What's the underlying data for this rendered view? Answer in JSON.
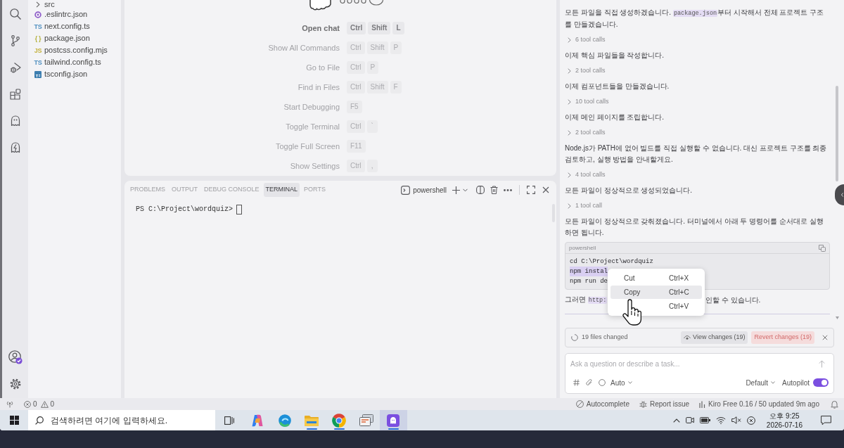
{
  "activity_bar": {
    "top": [
      {
        "kind": "search"
      },
      {
        "kind": "source_control"
      },
      {
        "kind": "run_debug"
      },
      {
        "kind": "extensions"
      },
      {
        "kind": "ghost"
      },
      {
        "kind": "ghost_bolt"
      }
    ],
    "bottom": [
      {
        "kind": "account"
      },
      {
        "kind": "settings"
      }
    ]
  },
  "explorer": {
    "items": [
      {
        "kind": "folder",
        "name": "src",
        "expanded": false
      },
      {
        "kind": "file",
        "name": ".eslintrc.json",
        "icon": {
          "kind": "ring",
          "color": "#8e5bc9"
        }
      },
      {
        "kind": "file",
        "name": "next.config.ts",
        "icon": {
          "kind": "glyph",
          "text": "TS",
          "color": "#4f8fc0"
        }
      },
      {
        "kind": "file",
        "name": "package.json",
        "icon": {
          "kind": "glyph",
          "text": "{ }",
          "color": "#b3b03a"
        }
      },
      {
        "kind": "file",
        "name": "postcss.config.mjs",
        "icon": {
          "kind": "glyph",
          "text": "JS",
          "color": "#c4b13e"
        }
      },
      {
        "kind": "file",
        "name": "tailwind.config.ts",
        "icon": {
          "kind": "glyph",
          "text": "TS",
          "color": "#4f8fc0"
        }
      },
      {
        "kind": "file",
        "name": "tsconfig.json",
        "icon": {
          "kind": "tile",
          "color": "#3d7eb0"
        }
      }
    ]
  },
  "welcome": {
    "shortcuts": [
      {
        "label": "Open chat",
        "keys": [
          "Ctrl",
          "Shift",
          "L"
        ],
        "emphasized": true
      },
      {
        "label": "Show All Commands",
        "keys": [
          "Ctrl",
          "Shift",
          "P"
        ],
        "emphasized": false
      },
      {
        "label": "Go to File",
        "keys": [
          "Ctrl",
          "P"
        ],
        "emphasized": false
      },
      {
        "label": "Find in Files",
        "keys": [
          "Ctrl",
          "Shift",
          "F"
        ],
        "emphasized": false
      },
      {
        "label": "Start Debugging",
        "keys": [
          "F5"
        ],
        "emphasized": false
      },
      {
        "label": "Toggle Terminal",
        "keys": [
          "Ctrl",
          "`"
        ],
        "emphasized": false
      },
      {
        "label": "Toggle Full Screen",
        "keys": [
          "F11"
        ],
        "emphasized": false
      },
      {
        "label": "Show Settings",
        "keys": [
          "Ctrl",
          ","
        ],
        "emphasized": false
      }
    ]
  },
  "panel": {
    "tabs": [
      {
        "label": "PROBLEMS",
        "selected": false
      },
      {
        "label": "OUTPUT",
        "selected": false
      },
      {
        "label": "DEBUG CONSOLE",
        "selected": false
      },
      {
        "label": "TERMINAL",
        "selected": true
      },
      {
        "label": "PORTS",
        "selected": false
      }
    ],
    "terminal": {
      "shell": "powershell",
      "prompt": "PS C:\\Project\\wordquiz>"
    }
  },
  "chat": {
    "items": [
      {
        "kind": "message",
        "segments": [
          {
            "kind": "text",
            "text": "모든 파일을 직접 생성하겠습니다. "
          },
          {
            "kind": "code",
            "text": "package.json"
          },
          {
            "kind": "text",
            "text": "부터 시작해서 전체 프로젝트 구조를 만들겠습니다."
          }
        ]
      },
      {
        "kind": "tool_calls",
        "label": "6 tool calls",
        "expanded": false
      },
      {
        "kind": "message",
        "segments": [
          {
            "kind": "text",
            "text": "이제 핵심 파일들을 작성합니다."
          }
        ]
      },
      {
        "kind": "tool_calls",
        "label": "2 tool calls",
        "expanded": false
      },
      {
        "kind": "message",
        "segments": [
          {
            "kind": "text",
            "text": "이제 컴포넌트들을 만들겠습니다."
          }
        ]
      },
      {
        "kind": "tool_calls",
        "label": "10 tool calls",
        "expanded": false
      },
      {
        "kind": "message",
        "segments": [
          {
            "kind": "text",
            "text": "이제 메인 페이지를 조립합니다."
          }
        ]
      },
      {
        "kind": "tool_calls",
        "label": "2 tool calls",
        "expanded": false
      },
      {
        "kind": "message",
        "segments": [
          {
            "kind": "text",
            "text": "Node.js가 PATH에 없어 빌드를 직접 실행할 수 없습니다. 대신 프로젝트 구조를 최종 검토하고, 실행 방법을 안내할게요."
          }
        ]
      },
      {
        "kind": "tool_calls",
        "label": "4 tool calls",
        "expanded": false
      },
      {
        "kind": "message",
        "segments": [
          {
            "kind": "text",
            "text": "모든 파일이 정상적으로 생성되었습니다."
          }
        ]
      },
      {
        "kind": "tool_calls",
        "label": "1 tool call",
        "expanded": false
      },
      {
        "kind": "message",
        "segments": [
          {
            "kind": "text",
            "text": "모든 파일이 정상적으로 갖춰졌습니다. 터미널에서 아래 두 명령어를 순서대로 실행하면 됩니다."
          }
        ]
      },
      {
        "kind": "code_block",
        "language": "powershell",
        "lines": [
          {
            "text": "cd C:\\Project\\wordquiz",
            "selected": false
          },
          {
            "text": "npm instal",
            "selected": true
          },
          {
            "text": "npm run de",
            "selected": false
          }
        ]
      },
      {
        "kind": "covered_message",
        "segments": [
          {
            "kind": "text",
            "text": "그러면 "
          },
          {
            "kind": "code",
            "text": "http:"
          }
        ],
        "tail": "인할 수 있습니다."
      }
    ],
    "changes": {
      "summary": "19 files changed",
      "view_label": "View changes (19)",
      "revert_label": "Revert changes (19)"
    },
    "composer": {
      "placeholder": "Ask a question or describe a task...",
      "mode": "Auto",
      "agent": "Default",
      "autopilot": {
        "label": "Autopilot",
        "on": true
      }
    },
    "context_menu": {
      "items": [
        {
          "label": "Cut",
          "shortcut": "Ctrl+X",
          "selected": false
        },
        {
          "label": "Copy",
          "shortcut": "Ctrl+C",
          "selected": true
        },
        {
          "shortcut": "Ctrl+V",
          "selected": false
        }
      ]
    }
  },
  "status_bar": {
    "problems": {
      "errors": "0",
      "warnings": "0"
    },
    "items": [
      {
        "kind": "autocomplete",
        "label": "Autocomplete"
      },
      {
        "kind": "report",
        "label": "Report issue"
      },
      {
        "kind": "usage",
        "label": "Kiro Free 0.16 / 50 updated 9m ago"
      }
    ]
  },
  "taskbar": {
    "search_placeholder": "검색하려면 여기에 입력하세요.",
    "apps": [
      {
        "kind": "letter_a",
        "running": false,
        "active": false
      },
      {
        "kind": "wave",
        "running": false,
        "active": false
      },
      {
        "kind": "folder",
        "running": true,
        "active": false
      },
      {
        "kind": "tricolor",
        "running": true,
        "active": false
      },
      {
        "kind": "stack",
        "running": false,
        "active": false
      },
      {
        "kind": "ghost",
        "running": true,
        "active": true
      }
    ],
    "time": "오후 9:25",
    "date": "2026-07-16"
  }
}
